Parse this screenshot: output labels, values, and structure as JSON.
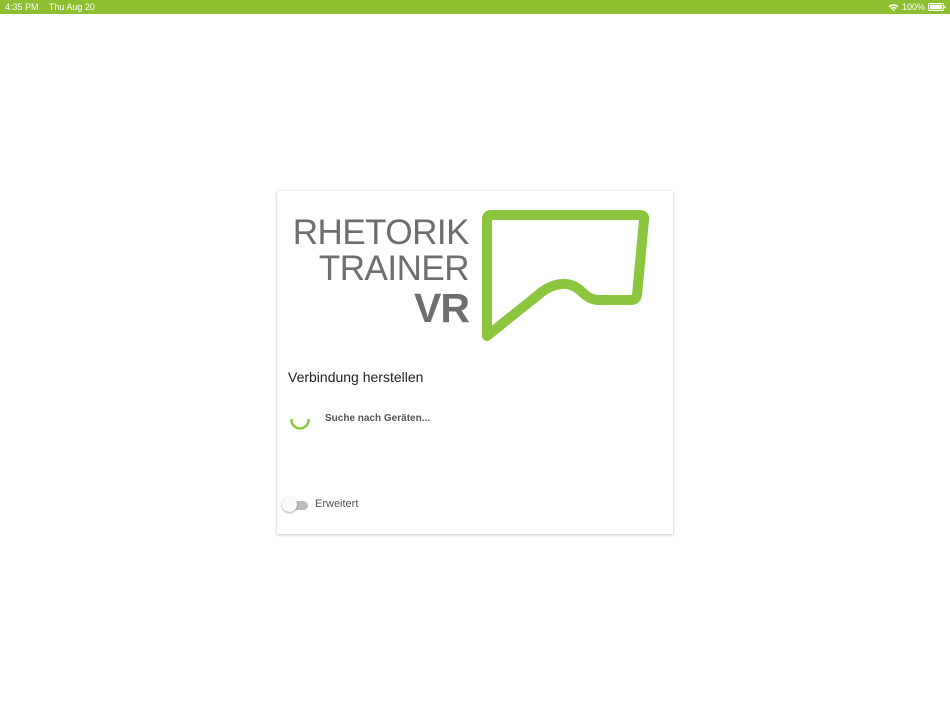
{
  "status_bar": {
    "time": "4:35 PM",
    "date": "Thu Aug 20",
    "battery": "100%",
    "icons": [
      "wifi-icon",
      "battery-icon"
    ]
  },
  "logo": {
    "line1": "RHETORIK",
    "line2": "TRAINER",
    "line3": "VR",
    "text_color": "#6d6e70",
    "accent_color": "#8cc63f",
    "icon": "speech-bubble-icon"
  },
  "dialog": {
    "title": "Verbindung herstellen",
    "status_text": "Suche nach Geräten...",
    "spinner_icon": "spinner-icon"
  },
  "advanced_toggle": {
    "label": "Erweitert",
    "checked": false
  },
  "colors": {
    "status_bar": "#8cc030",
    "accent": "#8cc63f"
  }
}
